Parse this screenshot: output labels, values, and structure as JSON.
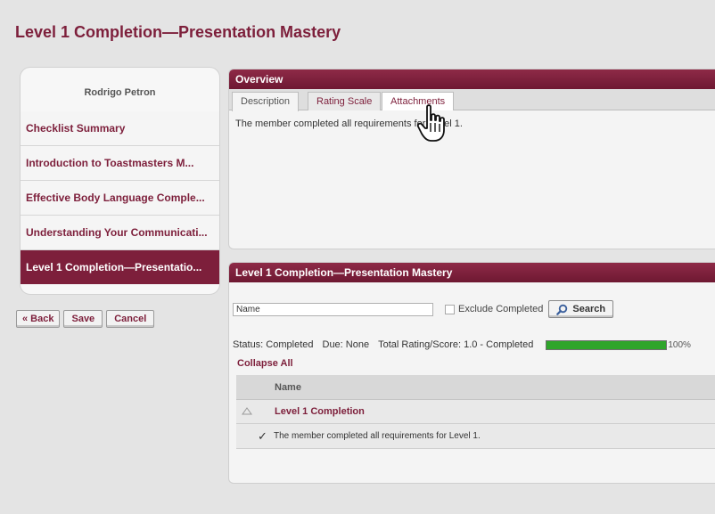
{
  "page": {
    "title": "Level 1 Completion—Presentation Mastery"
  },
  "sidebar": {
    "member_name": "Rodrigo Petron",
    "items": [
      {
        "label": "Checklist Summary"
      },
      {
        "label": "Introduction to Toastmasters M..."
      },
      {
        "label": "Effective Body Language Comple..."
      },
      {
        "label": "Understanding Your Communicati..."
      },
      {
        "label": "Level 1 Completion—Presentatio...",
        "active": true
      }
    ]
  },
  "actions": {
    "back": "« Back",
    "save": "Save",
    "cancel": "Cancel"
  },
  "overview": {
    "header": "Overview",
    "tabs": [
      {
        "label": "Description"
      },
      {
        "label": "Rating Scale"
      },
      {
        "label": "Attachments"
      }
    ],
    "description": "The member completed all requirements for Level 1."
  },
  "mastery": {
    "header": "Level 1 Completion—Presentation Mastery",
    "search": {
      "name_value": "Name",
      "exclude_label": "Exclude Completed",
      "search_label": "Search"
    },
    "status": {
      "status": "Status: Completed",
      "due": "Due: None",
      "rating": "Total Rating/Score: 1.0 - Completed",
      "progress_percent": 100,
      "progress_label": "100%"
    },
    "collapse_all": "Collapse All",
    "table": {
      "column_name": "Name",
      "group_label": "Level 1 Completion",
      "item_label": "The member completed all requirements for Level 1."
    }
  },
  "colors": {
    "brand": "#7d1f3b",
    "progress": "#2fa52b"
  },
  "icons": {
    "search": "magnifier-icon",
    "check": "checkmark-icon",
    "collapse": "triangle-up-icon",
    "cursor": "hand-pointer-icon"
  }
}
